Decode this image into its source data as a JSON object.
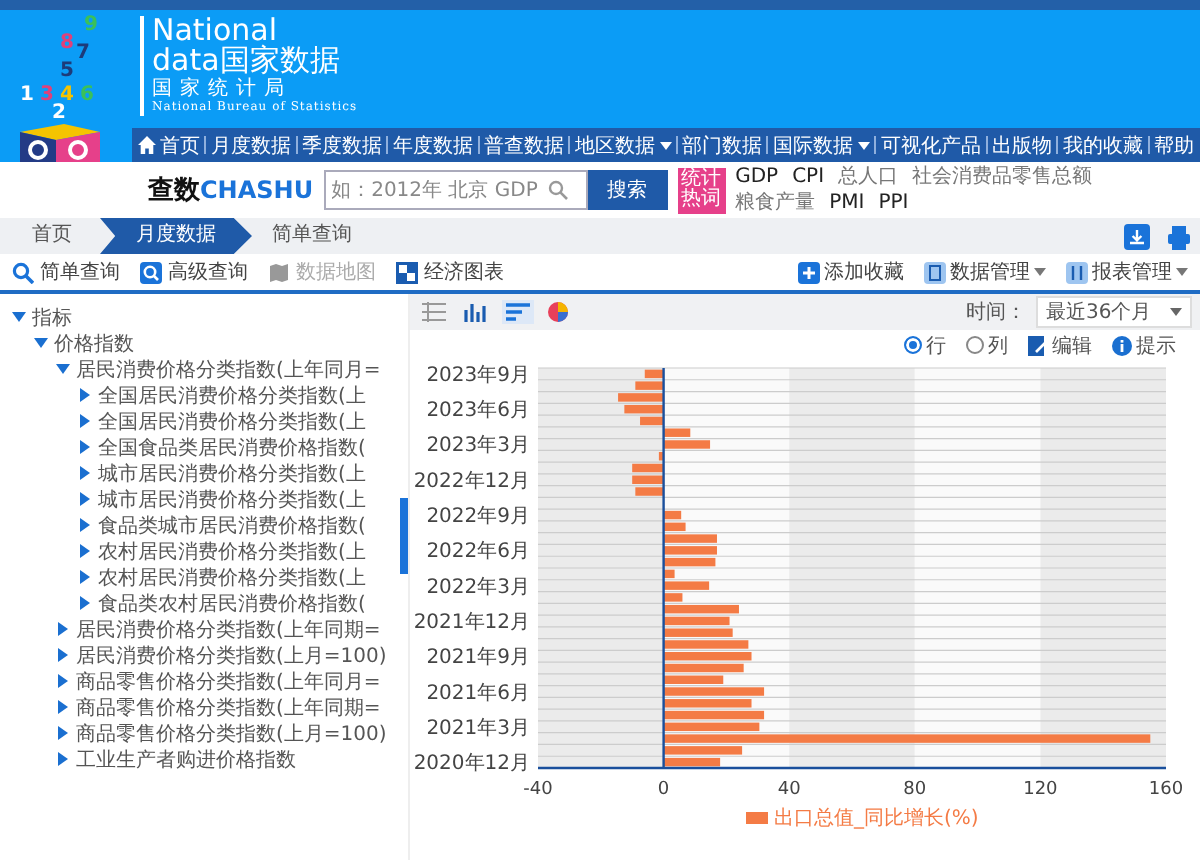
{
  "banner": {
    "logo_digits": [
      "9",
      "8",
      "7",
      "5",
      "1",
      "3",
      "4",
      "6",
      "2"
    ],
    "title_en": "National",
    "title_data": "data",
    "title_cn": "国家数据",
    "org_cn": "国家统计局",
    "org_en": "National Bureau of Statistics"
  },
  "nav": [
    {
      "label": "首页",
      "kind": "home",
      "has_menu": false
    },
    {
      "label": "月度数据",
      "kind": "link",
      "has_menu": false
    },
    {
      "label": "季度数据",
      "kind": "link",
      "has_menu": false
    },
    {
      "label": "年度数据",
      "kind": "link",
      "has_menu": false
    },
    {
      "label": "普查数据",
      "kind": "link",
      "has_menu": false
    },
    {
      "label": "地区数据",
      "kind": "link",
      "has_menu": true
    },
    {
      "label": "部门数据",
      "kind": "link",
      "has_menu": false
    },
    {
      "label": "国际数据",
      "kind": "link",
      "has_menu": true
    },
    {
      "label": "可视化产品",
      "kind": "link",
      "has_menu": false
    },
    {
      "label": "出版物",
      "kind": "link",
      "has_menu": false
    },
    {
      "label": "我的收藏",
      "kind": "link",
      "has_menu": false
    },
    {
      "label": "帮助",
      "kind": "link",
      "has_menu": false
    }
  ],
  "search": {
    "logo_cn": "查数",
    "logo_en": "CHASHU",
    "placeholder": "如：2012年 北京 GDP",
    "button": "搜索"
  },
  "hot_words": {
    "badge": "统计热词",
    "words": [
      {
        "label": "GDP",
        "muted": false
      },
      {
        "label": "CPI",
        "muted": false
      },
      {
        "label": "总人口",
        "muted": true
      },
      {
        "label": "社会消费品零售总额",
        "muted": true
      },
      {
        "label": "粮食产量",
        "muted": true
      },
      {
        "label": "PMI",
        "muted": false
      },
      {
        "label": "PPI",
        "muted": false
      }
    ]
  },
  "breadcrumb": [
    {
      "label": "首页",
      "selected": false
    },
    {
      "label": "月度数据",
      "selected": true
    },
    {
      "label": "简单查询",
      "selected": false
    }
  ],
  "tools": [
    {
      "label": "简单查询",
      "kind": "search",
      "disabled": false
    },
    {
      "label": "高级查询",
      "kind": "advanced",
      "disabled": false
    },
    {
      "label": "数据地图",
      "kind": "map",
      "disabled": true
    },
    {
      "label": "经济图表",
      "kind": "chart",
      "disabled": false
    }
  ],
  "actions": [
    {
      "label": "添加收藏",
      "kind": "add",
      "has_menu": false
    },
    {
      "label": "数据管理",
      "kind": "data",
      "has_menu": true
    },
    {
      "label": "报表管理",
      "kind": "report",
      "has_menu": true
    }
  ],
  "tree": [
    {
      "label": "指标",
      "expanded": true,
      "children": [
        {
          "label": "价格指数",
          "expanded": true,
          "children": [
            {
              "label": "居民消费价格分类指数(上年同月=",
              "expanded": true,
              "children": [
                {
                  "label": "全国居民消费价格分类指数(上",
                  "expanded": false
                },
                {
                  "label": "全国居民消费价格分类指数(上",
                  "expanded": false
                },
                {
                  "label": "全国食品类居民消费价格指数(",
                  "expanded": false
                },
                {
                  "label": "城市居民消费价格分类指数(上",
                  "expanded": false
                },
                {
                  "label": "城市居民消费价格分类指数(上",
                  "expanded": false
                },
                {
                  "label": "食品类城市居民消费价格指数(",
                  "expanded": false
                },
                {
                  "label": "农村居民消费价格分类指数(上",
                  "expanded": false
                },
                {
                  "label": "农村居民消费价格分类指数(上",
                  "expanded": false
                },
                {
                  "label": "食品类农村居民消费价格指数(",
                  "expanded": false
                }
              ]
            },
            {
              "label": "居民消费价格分类指数(上年同期=",
              "expanded": false
            },
            {
              "label": "居民消费价格分类指数(上月=100)",
              "expanded": false
            },
            {
              "label": "商品零售价格分类指数(上年同月=",
              "expanded": false
            },
            {
              "label": "商品零售价格分类指数(上年同期=",
              "expanded": false
            },
            {
              "label": "商品零售价格分类指数(上月=100)",
              "expanded": false
            },
            {
              "label": "工业生产者购进价格指数",
              "expanded": false
            }
          ]
        }
      ]
    }
  ],
  "chart_panel": {
    "view_types": [
      {
        "kind": "table",
        "selected": false
      },
      {
        "kind": "bar",
        "selected": false
      },
      {
        "kind": "hbar",
        "selected": true
      },
      {
        "kind": "pie",
        "selected": false
      }
    ],
    "time_label": "时间：",
    "time_value": "最近36个月",
    "layout_options": [
      {
        "label": "行",
        "selected": true
      },
      {
        "label": "列",
        "selected": false
      }
    ],
    "links": [
      {
        "label": "编辑",
        "kind": "edit"
      },
      {
        "label": "提示",
        "kind": "info"
      }
    ],
    "chart_data": {
      "type": "bar",
      "orientation": "horizontal",
      "categories": [
        "2023年9月",
        null,
        null,
        "2023年6月",
        null,
        null,
        "2023年3月",
        null,
        null,
        "2022年12月",
        null,
        null,
        "2022年9月",
        null,
        null,
        "2022年6月",
        null,
        null,
        "2022年3月",
        null,
        null,
        "2021年12月",
        null,
        null,
        "2021年9月",
        null,
        null,
        "2021年6月",
        null,
        null,
        "2021年3月",
        null,
        null,
        "2020年12月"
      ],
      "series": [
        {
          "name": "出口总值_同比增长(%)",
          "color": "#f47b45",
          "values": [
            -6,
            -9,
            -14.5,
            -12.5,
            -7.5,
            8.5,
            14.8,
            -1.5,
            -10,
            -10,
            -9,
            null,
            5.6,
            7,
            17,
            17,
            16.5,
            3.5,
            14.5,
            6,
            24,
            21,
            22,
            27,
            28,
            25.5,
            19,
            32,
            28,
            32,
            30.5,
            155,
            25,
            18
          ]
        }
      ],
      "ref_lines": [
        {
          "axis": "x",
          "value": 0
        }
      ],
      "xlim": [
        -40,
        160
      ],
      "xticks": [
        -40,
        0,
        40,
        80,
        120,
        160
      ]
    }
  }
}
